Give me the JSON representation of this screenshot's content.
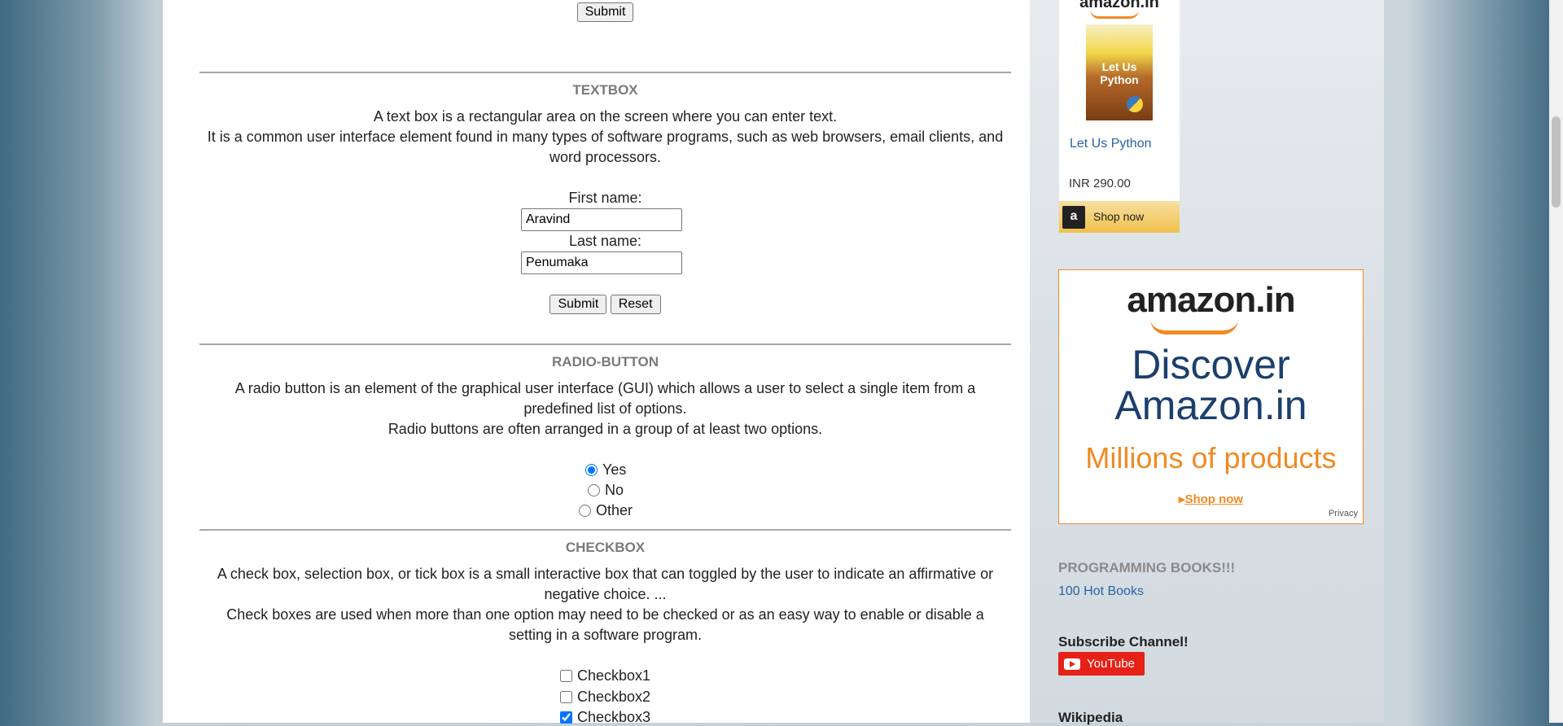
{
  "top": {
    "submit_label": "Submit"
  },
  "textbox": {
    "heading": "TEXTBOX",
    "line1": "A text box is a rectangular area on the screen where you can enter text.",
    "line2": "It is a common user interface element found in many types of software programs, such as web browsers, email clients, and word processors.",
    "first_label": "First name:",
    "first_value": "Aravind",
    "last_label": "Last name:",
    "last_value": "Penumaka",
    "submit_label": "Submit",
    "reset_label": "Reset"
  },
  "radio": {
    "heading": "RADIO-BUTTON",
    "line1": "A radio button is an element of the graphical user interface (GUI) which allows a user to select a single item from a predefined list of options.",
    "line2": "Radio buttons are often arranged in a group of at least two options.",
    "options": [
      {
        "label": "Yes",
        "checked": true
      },
      {
        "label": "No",
        "checked": false
      },
      {
        "label": "Other",
        "checked": false
      }
    ]
  },
  "checkbox": {
    "heading": "CHECKBOX",
    "line1": "A check box, selection box, or tick box is a small interactive box that can toggled by the user to indicate an affirmative or negative choice. ...",
    "line2": "Check boxes are used when more than one option may need to be checked or as an easy way to enable or disable a setting in a software program.",
    "options": [
      {
        "label": "Checkbox1",
        "checked": false
      },
      {
        "label": "Checkbox2",
        "checked": false
      },
      {
        "label": "Checkbox3",
        "checked": true
      }
    ]
  },
  "sidebar": {
    "ad_small": {
      "brand": "amazon.in",
      "book_cover_title": "Let Us Python",
      "book_title": "Let Us Python",
      "price": "INR 290.00",
      "shop_label": "Shop now"
    },
    "ad_big": {
      "brand": "amazon.in",
      "headline1": "Discover",
      "headline2": "Amazon.in",
      "tagline": "Millions of products",
      "shop_label": "Shop now",
      "privacy_label": "Privacy"
    },
    "books_heading": "PROGRAMMING BOOKS!!!",
    "books_link": "100 Hot Books",
    "subscribe_heading": "Subscribe Channel!",
    "youtube_label": "YouTube",
    "wiki_heading": "Wikipedia"
  },
  "colors": {
    "accent_orange": "#f08a24",
    "link_blue": "#2a62a6",
    "youtube_red": "#e62117"
  }
}
